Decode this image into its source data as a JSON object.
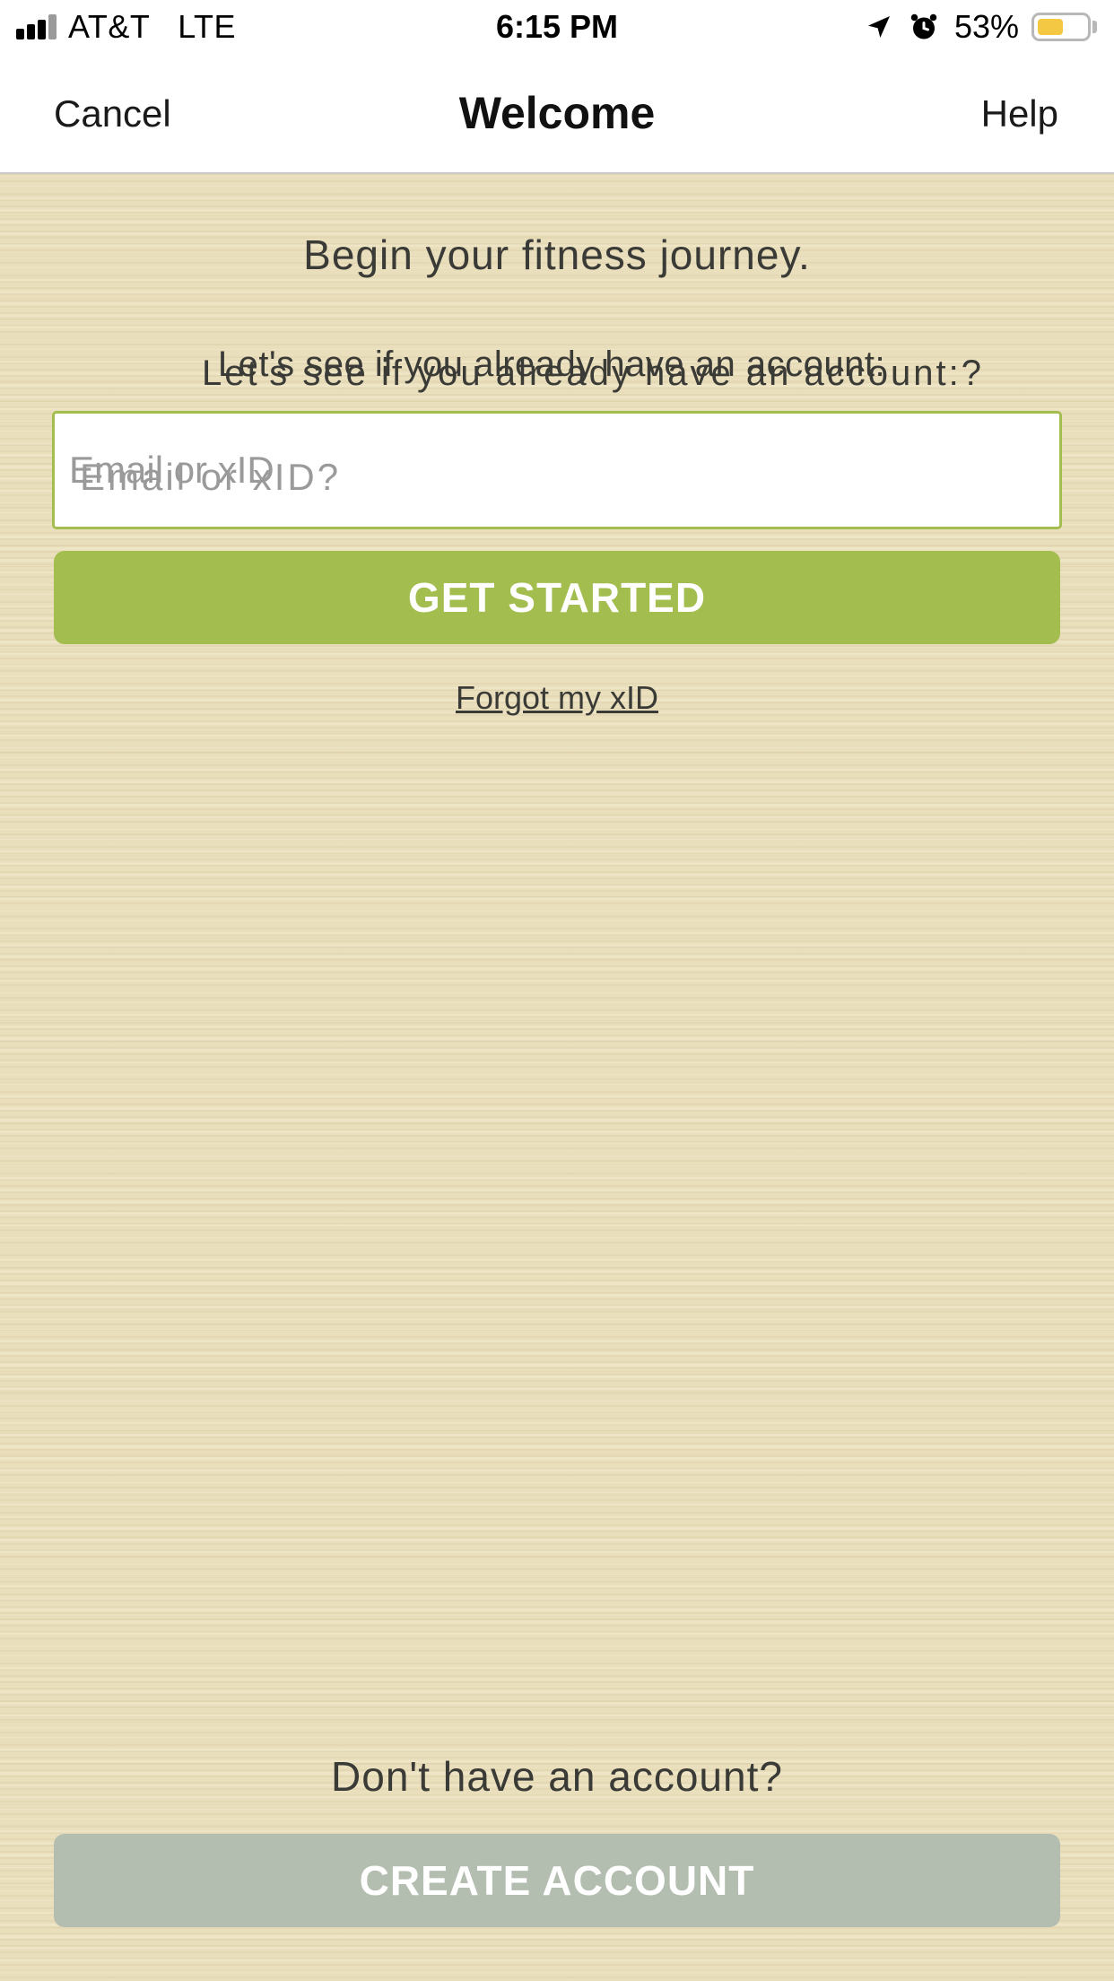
{
  "status_bar": {
    "carrier": "AT&T   LTE",
    "time": "6:15 PM",
    "battery_percent": "53%",
    "battery_level": 0.53,
    "icons": [
      "signal-icon",
      "location-arrow-icon",
      "alarm-clock-icon",
      "battery-icon"
    ]
  },
  "nav": {
    "cancel": "Cancel",
    "title": "Welcome",
    "help": "Help"
  },
  "main": {
    "headline": "Begin your fitness journey.",
    "subline": "Let's see if you already have an account:",
    "subline_overlay": "Let's see if you already have an account:?",
    "email": {
      "placeholder": "Email or xID",
      "placeholder_overlay": "Email or xID?",
      "value": ""
    },
    "get_started": "GET STARTED",
    "forgot": "Forgot my xID",
    "no_account": "Don't have an account?",
    "create_account": "CREATE ACCOUNT"
  },
  "colors": {
    "accent_green": "#a3bd4f",
    "create_button": "#b3beb0",
    "background": "#eadfbd",
    "battery_fill": "#f4c842"
  }
}
